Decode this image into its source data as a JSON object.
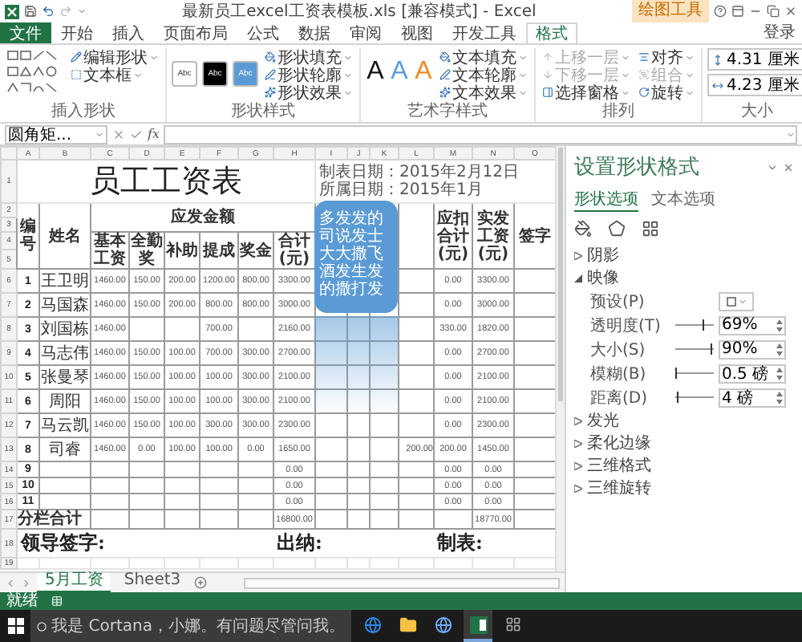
{
  "window": {
    "title": "最新员工excel工资表模板.xls [兼容模式] - Excel",
    "context_tab": "绘图工具"
  },
  "ribbon": {
    "tabs": [
      {
        "label": "文件",
        "kind": "file",
        "selected": false
      },
      {
        "label": "开始",
        "kind": "tab",
        "selected": false
      },
      {
        "label": "插入",
        "kind": "tab",
        "selected": false
      },
      {
        "label": "页面布局",
        "kind": "tab",
        "selected": false
      },
      {
        "label": "公式",
        "kind": "tab",
        "selected": false
      },
      {
        "label": "数据",
        "kind": "tab",
        "selected": false
      },
      {
        "label": "审阅",
        "kind": "tab",
        "selected": false
      },
      {
        "label": "视图",
        "kind": "tab",
        "selected": false
      },
      {
        "label": "开发工具",
        "kind": "tab",
        "selected": false
      },
      {
        "label": "格式",
        "kind": "tab",
        "selected": true
      }
    ],
    "account": "登录",
    "groups": [
      {
        "label": "插入形状",
        "kind": "shapes",
        "commands": [
          {
            "label": "编辑形状",
            "disabled": false
          },
          {
            "label": "文本框",
            "disabled": false
          }
        ]
      },
      {
        "label": "形状样式",
        "kind": "styles",
        "swatches": [
          "Abc",
          "Abc",
          "Abc"
        ],
        "commands": [
          {
            "label": "形状填充",
            "disabled": false
          },
          {
            "label": "形状轮廓",
            "disabled": false
          },
          {
            "label": "形状效果",
            "disabled": false
          }
        ]
      },
      {
        "label": "艺术字样式",
        "kind": "wordart",
        "swatches": [
          "A",
          "A",
          "A"
        ],
        "commands": [
          {
            "label": "文本填充",
            "disabled": false
          },
          {
            "label": "文本轮廓",
            "disabled": false
          },
          {
            "label": "文本效果",
            "disabled": false
          }
        ]
      },
      {
        "label": "排列",
        "kind": "arrange",
        "commands": [
          {
            "label": "上移一层",
            "disabled": true
          },
          {
            "label": "下移一层",
            "disabled": true
          },
          {
            "label": "选择窗格",
            "disabled": false
          },
          {
            "label": "对齐",
            "disabled": false
          },
          {
            "label": "组合",
            "disabled": true
          },
          {
            "label": "旋转",
            "disabled": false
          }
        ]
      },
      {
        "label": "大小",
        "kind": "size",
        "fields": [
          "4.31 厘米",
          "4.23 厘米"
        ]
      }
    ]
  },
  "formula_bar": {
    "name_box": "圆角矩...",
    "function_label": "fx"
  },
  "sheet": {
    "columns": [
      "A",
      "B",
      "C",
      "D",
      "E",
      "F",
      "G",
      "H",
      "I",
      "J",
      "K",
      "L",
      "M",
      "N",
      "O"
    ],
    "row_labels": [
      "1",
      "2",
      "3",
      "4",
      "5",
      "6",
      "7",
      "8",
      "9",
      "10",
      "11",
      "12",
      "13",
      "14",
      "15",
      "16",
      "17",
      "18",
      "19"
    ],
    "title": "员工工资表",
    "date_label": "制表日期：",
    "date_value": "2015年2月12日",
    "period_label": "所属日期：",
    "period_value": "2015年1月",
    "headers": {
      "number": "编号",
      "name": "姓名",
      "group": "应发金额",
      "items": [
        "基本工资",
        "全勤奖",
        "补助",
        "提成",
        "奖金",
        "合计(元)"
      ],
      "deductions": "应扣合计(元)",
      "net": "实发工资(元)",
      "signature": "签字"
    },
    "rows": [
      {
        "number": "1",
        "name": "王卫明",
        "amounts": {
          "basic": "1460.00",
          "attendance": "150.00",
          "allowance": "200.00",
          "commission": "1200.00",
          "bonus": "800.00",
          "total": "3300.00"
        },
        "deductions": "0.00",
        "net": "3300.00"
      },
      {
        "number": "2",
        "name": "马国森",
        "amounts": {
          "basic": "1460.00",
          "attendance": "150.00",
          "allowance": "200.00",
          "commission": "800.00",
          "bonus": "800.00",
          "total": "3000.00"
        },
        "deductions": "0.00",
        "net": "3000.00"
      },
      {
        "number": "3",
        "name": "刘国栋",
        "amounts": {
          "basic": "1460.00",
          "commission": "700.00",
          "total": "2160.00"
        },
        "deductions": "330.00",
        "net": "1820.00"
      },
      {
        "number": "4",
        "name": "马志伟",
        "amounts": {
          "basic": "1460.00",
          "attendance": "150.00",
          "allowance": "100.00",
          "commission": "700.00",
          "bonus": "300.00",
          "total": "2700.00"
        },
        "deductions": "0.00",
        "net": "2700.00"
      },
      {
        "number": "5",
        "name": "张曼琴",
        "amounts": {
          "basic": "1460.00",
          "attendance": "150.00",
          "allowance": "100.00",
          "commission": "100.00",
          "bonus": "300.00",
          "total": "2100.00"
        },
        "deductions": "0.00",
        "net": "2100.00"
      },
      {
        "number": "6",
        "name": "周阳",
        "amounts": {
          "basic": "1460.00",
          "attendance": "150.00",
          "allowance": "100.00",
          "commission": "100.00",
          "bonus": "300.00",
          "total": "2100.00"
        },
        "deductions": "0.00",
        "net": "2100.00"
      },
      {
        "number": "7",
        "name": "马云凯",
        "amounts": {
          "basic": "1460.00",
          "attendance": "150.00",
          "allowance": "100.00",
          "commission": "300.00",
          "bonus": "300.00",
          "total": "2300.00"
        },
        "deductions": "0.00",
        "net": "2300.00"
      },
      {
        "number": "8",
        "name": "司睿",
        "amounts": {
          "basic": "1460.00",
          "attendance": "0.00",
          "allowance": "100.00",
          "commission": "100.00",
          "bonus": "0.00",
          "total": "1650.00"
        },
        "column_l": "200.00",
        "deductions": "200.00",
        "net": "1450.00"
      },
      {
        "number": "9",
        "amounts": {
          "total": "0.00"
        },
        "deductions": "0.00",
        "net": "0.00"
      },
      {
        "number": "10",
        "amounts": {
          "total": "0.00"
        },
        "deductions": "0.00",
        "net": "0.00"
      },
      {
        "number": "11",
        "amounts": {
          "total": "0.00"
        },
        "deductions": "0.00",
        "net": "0.00"
      }
    ],
    "subtotal": {
      "label": "分栏合计",
      "total": "16800.00",
      "net": "18770.00"
    },
    "footer": [
      "领导签字:",
      "出纳:",
      "制表:"
    ],
    "shape": {
      "text": "多发发的司说发士大大撒飞酒发生发的撒打发"
    },
    "sheet_tabs": [
      {
        "label": "5月工资",
        "selected": true
      },
      {
        "label": "Sheet3",
        "selected": false
      }
    ]
  },
  "status_bar": {
    "text": "就绪"
  },
  "format_pane": {
    "title": "设置形状格式",
    "tabs": [
      {
        "label": "形状选项",
        "selected": true
      },
      {
        "label": "文本选项",
        "selected": false
      }
    ],
    "sections": [
      {
        "label": "阴影",
        "expanded": false
      },
      {
        "label": "映像",
        "expanded": true,
        "settings": [
          {
            "label": "预设(P)",
            "kind": "preset"
          },
          {
            "label": "透明度(T)",
            "kind": "slider",
            "level": 0.69,
            "value": "69%"
          },
          {
            "label": "大小(S)",
            "kind": "slider",
            "level": 0.9,
            "value": "90%"
          },
          {
            "label": "模糊(B)",
            "kind": "slider",
            "level": 0.02,
            "value": "0.5 磅"
          },
          {
            "label": "距离(D)",
            "kind": "slider",
            "level": 0.04,
            "value": "4 磅"
          }
        ]
      },
      {
        "label": "发光",
        "expanded": false
      },
      {
        "label": "柔化边缘",
        "expanded": false
      },
      {
        "label": "三维格式",
        "expanded": false
      },
      {
        "label": "三维旋转",
        "expanded": false
      }
    ]
  },
  "taskbar": {
    "search_placeholder": "我是 Cortana，小娜。有问题尽管问我。"
  }
}
